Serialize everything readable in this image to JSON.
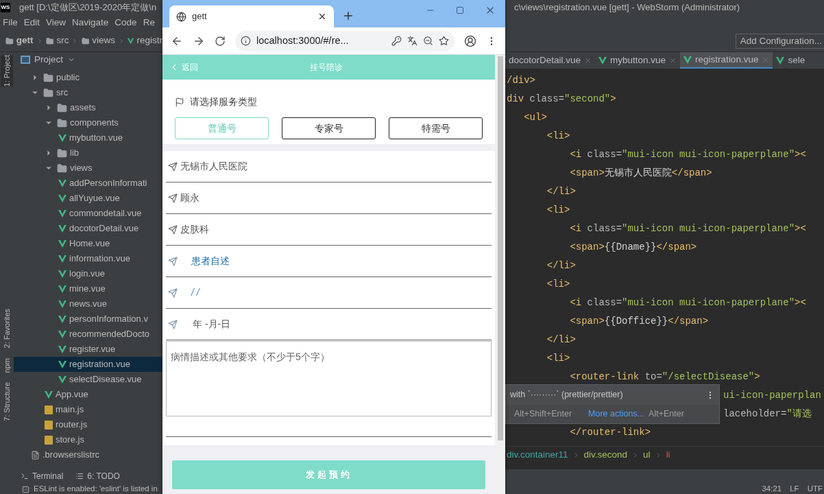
{
  "ide": {
    "logo": "WS",
    "title_left": "gett [D:\\定做区\\2019-2020年定做\\n",
    "title_right": "c\\views\\registration.vue [gett] - WebStorm (Administrator)",
    "menu": [
      "File",
      "Edit",
      "View",
      "Navigate",
      "Code",
      "Re"
    ],
    "nav_path": [
      "gett",
      "src",
      "views",
      "registr"
    ],
    "run_config": "Add Configuration...",
    "side_tools": [
      {
        "label": "1: Project",
        "selected": true
      },
      {
        "label": "2: Favorites",
        "selected": false
      },
      {
        "label": "npm",
        "selected": false
      },
      {
        "label": "7: Structure",
        "selected": false
      }
    ],
    "project_panel": {
      "title": "Project",
      "tree": [
        {
          "kind": "folder",
          "name": "public",
          "expanded": false,
          "selected": false
        },
        {
          "kind": "folder",
          "name": "src",
          "expanded": true,
          "selected": false,
          "children": [
            {
              "kind": "folder",
              "name": "assets",
              "expanded": false,
              "selected": false
            },
            {
              "kind": "folder",
              "name": "components",
              "expanded": true,
              "selected": false,
              "children": [
                {
                  "kind": "vue",
                  "name": "mybutton.vue",
                  "selected": false
                }
              ]
            },
            {
              "kind": "folder",
              "name": "lib",
              "expanded": false,
              "selected": false
            },
            {
              "kind": "folder",
              "name": "views",
              "expanded": true,
              "selected": false,
              "children": [
                {
                  "kind": "vue",
                  "name": "addPersonInformati",
                  "selected": false
                },
                {
                  "kind": "vue",
                  "name": "allYuyue.vue",
                  "selected": false
                },
                {
                  "kind": "vue",
                  "name": "commondetail.vue",
                  "selected": false
                },
                {
                  "kind": "vue",
                  "name": "docotorDetail.vue",
                  "selected": false
                },
                {
                  "kind": "vue",
                  "name": "Home.vue",
                  "selected": false
                },
                {
                  "kind": "vue",
                  "name": "information.vue",
                  "selected": false
                },
                {
                  "kind": "vue",
                  "name": "login.vue",
                  "selected": false
                },
                {
                  "kind": "vue",
                  "name": "mine.vue",
                  "selected": false
                },
                {
                  "kind": "vue",
                  "name": "news.vue",
                  "selected": false
                },
                {
                  "kind": "vue",
                  "name": "personInformation.v",
                  "selected": false
                },
                {
                  "kind": "vue",
                  "name": "recommendedDocto",
                  "selected": false
                },
                {
                  "kind": "vue",
                  "name": "register.vue",
                  "selected": false
                },
                {
                  "kind": "vue",
                  "name": "registration.vue",
                  "selected": true
                },
                {
                  "kind": "vue",
                  "name": "selectDisease.vue",
                  "selected": false
                }
              ]
            },
            {
              "kind": "vue",
              "name": "App.vue",
              "selected": false
            },
            {
              "kind": "js",
              "name": "main.js",
              "selected": false
            },
            {
              "kind": "js",
              "name": "router.js",
              "selected": false
            },
            {
              "kind": "js",
              "name": "store.js",
              "selected": false
            }
          ]
        },
        {
          "kind": "file",
          "name": ".browserslistrc",
          "selected": false
        }
      ]
    },
    "editor": {
      "tabs": [
        {
          "label": "docotorDetail.vue",
          "selected": false
        },
        {
          "label": "mybutton.vue",
          "selected": false
        },
        {
          "label": "registration.vue",
          "selected": true
        },
        {
          "label": "sele",
          "selected": false
        }
      ],
      "lines": [
        {
          "kind": "code",
          "tokens": [
            {
              "kind": "tag",
              "text": "/div>"
            }
          ]
        },
        {
          "kind": "code",
          "tokens": [
            {
              "kind": "tag",
              "text": "div"
            },
            {
              "kind": "attr",
              "text": " class="
            },
            {
              "kind": "value",
              "text": "\"second\""
            },
            {
              "kind": "tag",
              "text": ">"
            }
          ]
        },
        {
          "kind": "code",
          "tokens": [
            {
              "kind": "tag",
              "text": "   <ul>"
            }
          ]
        },
        {
          "kind": "code",
          "tokens": [
            {
              "kind": "tag",
              "text": "       <li>"
            }
          ]
        },
        {
          "kind": "code",
          "tokens": [
            {
              "kind": "tag",
              "text": "           <i"
            },
            {
              "kind": "attr",
              "text": " class="
            },
            {
              "kind": "value",
              "text": "\"mui-icon mui-icon-paperplane\""
            },
            {
              "kind": "tag",
              "text": "><"
            }
          ]
        },
        {
          "kind": "code",
          "tokens": [
            {
              "kind": "tag",
              "text": "           <span>"
            },
            {
              "kind": "text",
              "text": "无锡市人民医院"
            },
            {
              "kind": "tag",
              "text": "</span>"
            }
          ]
        },
        {
          "kind": "code",
          "tokens": [
            {
              "kind": "tag",
              "text": "       </li>"
            }
          ]
        },
        {
          "kind": "code",
          "tokens": [
            {
              "kind": "tag",
              "text": "       <li>"
            }
          ]
        },
        {
          "kind": "code",
          "tokens": [
            {
              "kind": "tag",
              "text": "           <i"
            },
            {
              "kind": "attr",
              "text": " class="
            },
            {
              "kind": "value",
              "text": "\"mui-icon mui-icon-paperplane\""
            },
            {
              "kind": "tag",
              "text": "><"
            }
          ]
        },
        {
          "kind": "code",
          "tokens": [
            {
              "kind": "tag",
              "text": "           <span>"
            },
            {
              "kind": "text",
              "text": "{{Dname}}"
            },
            {
              "kind": "tag",
              "text": "</span>"
            }
          ]
        },
        {
          "kind": "code",
          "tokens": [
            {
              "kind": "tag",
              "text": "       </li>"
            }
          ]
        },
        {
          "kind": "code",
          "tokens": [
            {
              "kind": "tag",
              "text": "       <li>"
            }
          ]
        },
        {
          "kind": "code",
          "tokens": [
            {
              "kind": "tag",
              "text": "           <i"
            },
            {
              "kind": "attr",
              "text": " class="
            },
            {
              "kind": "value",
              "text": "\"mui-icon mui-icon-paperplane\""
            },
            {
              "kind": "tag",
              "text": "><"
            }
          ]
        },
        {
          "kind": "code",
          "tokens": [
            {
              "kind": "tag",
              "text": "           <span>"
            },
            {
              "kind": "text",
              "text": "{{Doffice}}"
            },
            {
              "kind": "tag",
              "text": "</span>"
            }
          ]
        },
        {
          "kind": "code",
          "tokens": [
            {
              "kind": "tag",
              "text": "       </li>"
            }
          ]
        },
        {
          "kind": "code",
          "tokens": [
            {
              "kind": "tag",
              "text": "       <li>"
            }
          ]
        },
        {
          "kind": "code",
          "tokens": [
            {
              "kind": "tag",
              "text": "           <router-link"
            },
            {
              "kind": "attr",
              "text": " to="
            },
            {
              "kind": "value",
              "text": "\"/selectDisease\""
            },
            {
              "kind": "tag",
              "text": ">"
            }
          ]
        },
        {
          "kind": "tail",
          "tokens": [
            {
              "kind": "value",
              "text": "ui-icon-paperplan"
            }
          ]
        },
        {
          "kind": "tail",
          "tokens": [
            {
              "kind": "attr",
              "text": "laceholder="
            },
            {
              "kind": "value",
              "text": "\"请选"
            }
          ]
        },
        {
          "kind": "code",
          "tokens": [
            {
              "kind": "tag",
              "text": "           </router-link>"
            }
          ]
        }
      ],
      "popup": {
        "message": "with `·········` (prettier/prettier)",
        "shortcut": "Alt+Shift+Enter",
        "more": "More actions...",
        "more_shortcut": "Alt+Enter"
      },
      "breadcrumb": [
        "div.container11",
        "div.second",
        "ul",
        "li"
      ]
    },
    "tool_tabs": [
      {
        "kind": "terminal",
        "label": "Terminal"
      },
      {
        "kind": "todo",
        "label": "6: TODO"
      }
    ],
    "status": {
      "message": "ESLint is enabled: 'eslint' is listed in",
      "position": "34:21",
      "line_separator": "LF",
      "encoding": "UTF"
    }
  },
  "browser": {
    "tab_title": "gett",
    "url": "localhost:3000/#/re...",
    "page": {
      "back": "返回",
      "title": "挂号陪诊",
      "service_label": "请选择服务类型",
      "service_types": [
        {
          "label": "普通号",
          "selected": true
        },
        {
          "label": "专家号",
          "selected": false
        },
        {
          "label": "特需号",
          "selected": false
        }
      ],
      "rows": [
        {
          "kind": "plain",
          "text": "无锡市人民医院"
        },
        {
          "kind": "plain",
          "text": "顾永"
        },
        {
          "kind": "plain",
          "text": "皮肤科"
        },
        {
          "kind": "link",
          "text": "患者自述"
        },
        {
          "kind": "input",
          "text": "/ /"
        },
        {
          "kind": "date",
          "text": "年 -月-日"
        }
      ],
      "description_placeholder": "病情描述或其他要求（不少于5个字）",
      "submit": "发起预约"
    }
  }
}
